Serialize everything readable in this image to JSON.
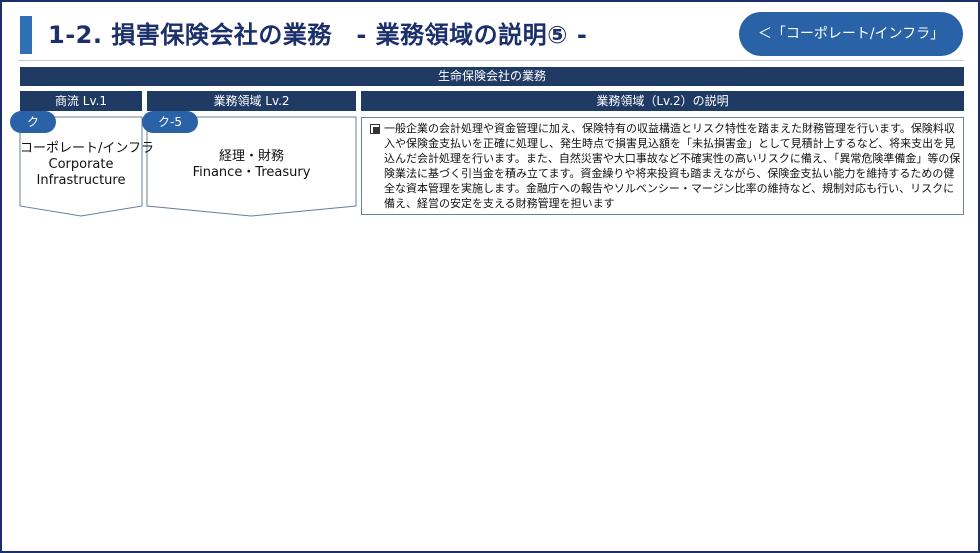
{
  "header": {
    "title": "1-2. 損害保険会社の業務　- 業務領域の説明⑤ -",
    "nav_button_label": "＜「コーポレート/インフラ」"
  },
  "table": {
    "company_header": "生命保険会社の業務",
    "column_headers": {
      "lv1": "商流 Lv.1",
      "lv2": "業務領域 Lv.2",
      "description": "業務領域（Lv.2）の説明"
    },
    "row": {
      "lv1_code": "ク",
      "lv1_name_ja": "コーポレート/インフラ",
      "lv1_name_en_1": "Corporate",
      "lv1_name_en_2": "Infrastructure",
      "lv2_code": "ク-5",
      "lv2_name_ja": "経理・財務",
      "lv2_name_en": "Finance・Treasury",
      "description": "一般企業の会計処理や資金管理に加え、保険特有の収益構造とリスク特性を踏まえた財務管理を行います。保険料収入や保険金支払いを正確に処理し、発生時点で損害見込額を「未払損害金」として見積計上するなど、将来支出を見込んだ会計処理を行います。また、自然災害や大口事故など不確実性の高いリスクに備え、「異常危険準備金」等の保険業法に基づく引当金を積み立てます。資金繰りや将来投資も踏まえながら、保険金支払い能力を維持するための健全な資本管理を実施します。金融庁への報告やソルベンシー・マージン比率の維持など、規制対応も行い、リスクに備え、経営の安定を支える財務管理を担います"
    }
  },
  "colors": {
    "title_text": "#1b2f6b",
    "accent": "#2f6fb3",
    "header_bar": "#1f3a63",
    "badge": "#2a62a8"
  }
}
